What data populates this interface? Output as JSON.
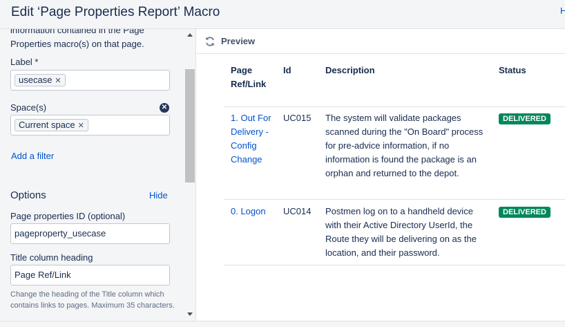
{
  "header": {
    "title": "Edit ‘Page Properties Report’ Macro",
    "help_link": "H"
  },
  "left": {
    "description": "information contained in the Page Properties macro(s) on that page.",
    "label_field": {
      "label": "Label *",
      "value": "usecase"
    },
    "space_field": {
      "label": "Space(s)",
      "value": "Current space"
    },
    "add_filter": "Add a filter",
    "options": {
      "heading": "Options",
      "hide": "Hide"
    },
    "page_props_id": {
      "label": "Page properties ID (optional)",
      "value": "pageproperty_usecase"
    },
    "title_col": {
      "label": "Title column heading",
      "value": "Page Ref/Link",
      "help": "Change the heading of the Title column which contains links to pages. Maximum 35 characters."
    }
  },
  "preview": {
    "label": "Preview",
    "refresh_icon": "refresh-icon"
  },
  "table": {
    "headers": [
      "Page Ref/Link",
      "Id",
      "Description",
      "Status"
    ],
    "rows": [
      {
        "page": "1. Out For Delivery - Config Change",
        "id": "UC015",
        "description": "The system will validate packages scanned during the \"On Board\" process for pre-advice information, if no information is found the package is an orphan and returned to the depot.",
        "status": "DELIVERED"
      },
      {
        "page": "0. Logon",
        "id": "UC014",
        "description": "Postmen log on to a handheld device with their Active Directory UserId, the Route they will be delivering on as the location, and their password.",
        "status": "DELIVERED"
      }
    ]
  },
  "colors": {
    "accent": "#0052cc",
    "status_green": "#00875a"
  }
}
